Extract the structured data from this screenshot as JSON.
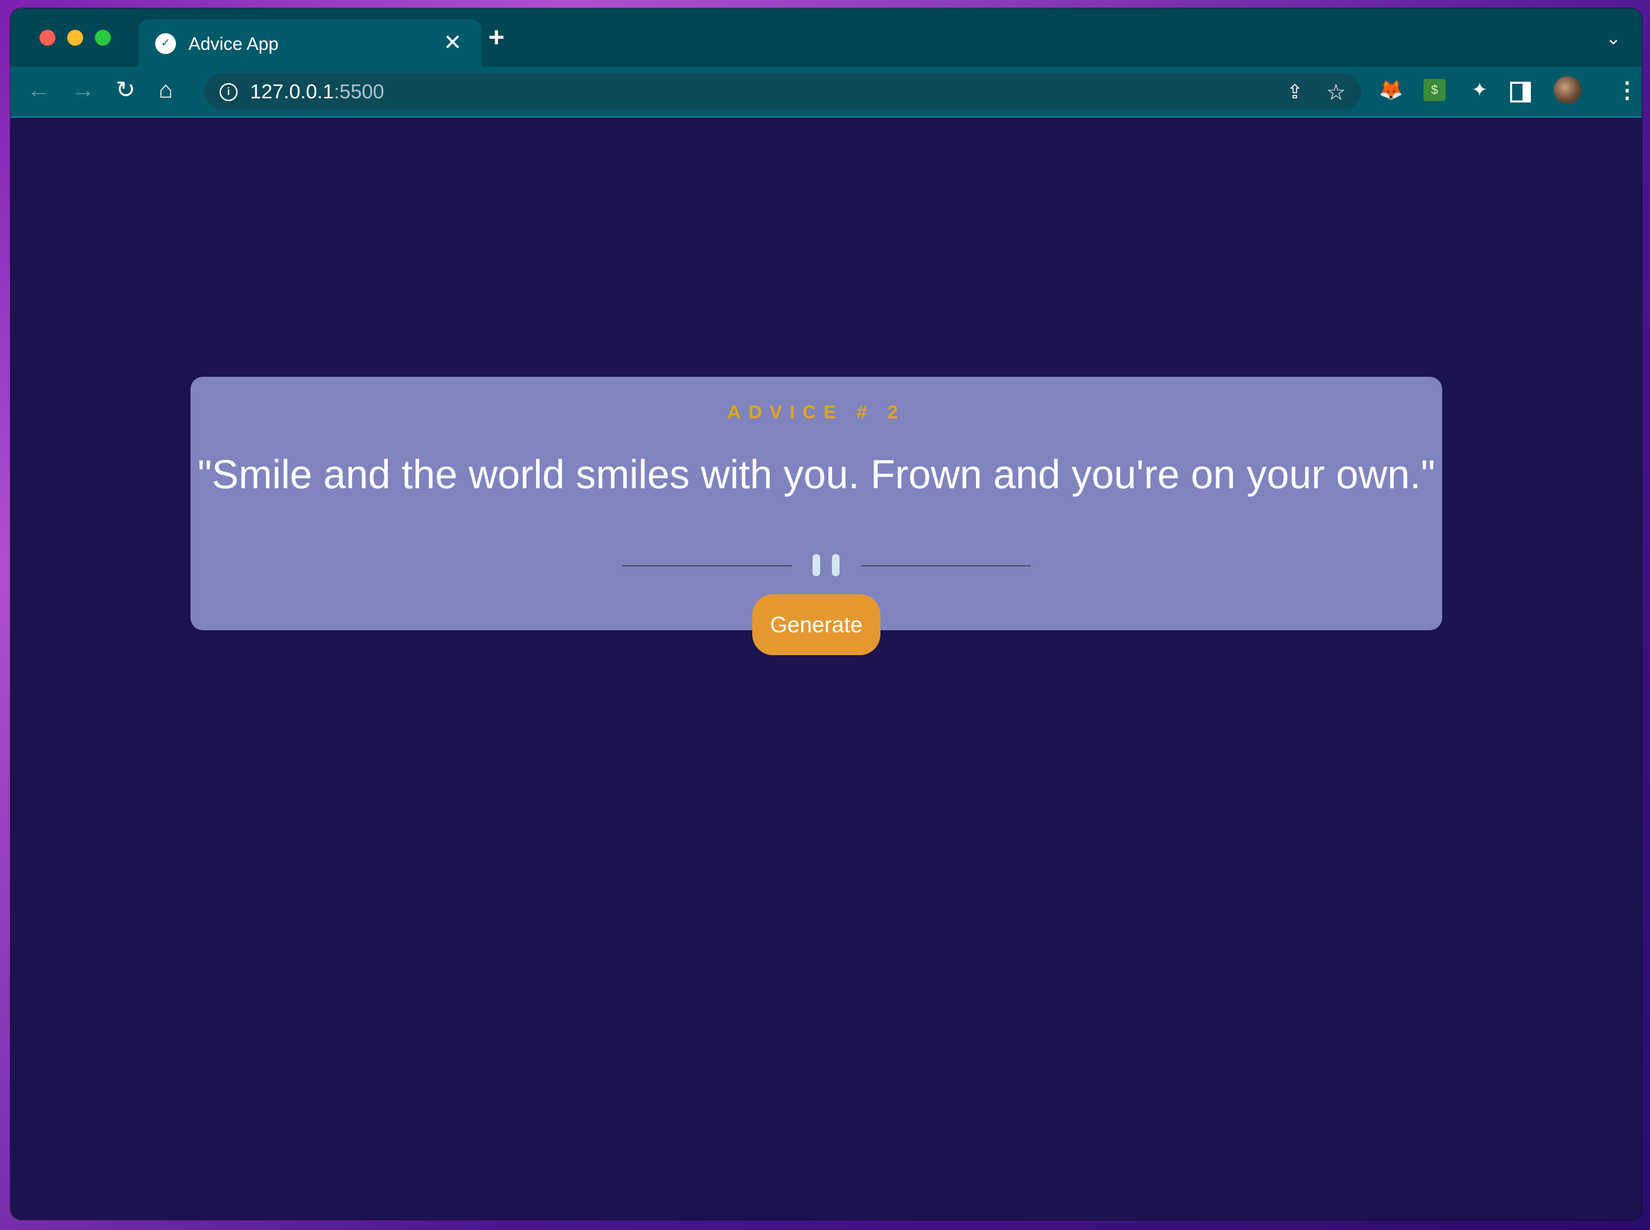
{
  "browser": {
    "tab_title": "Advice App",
    "tab_close": "✕",
    "new_tab": "+",
    "tab_list": "⌄",
    "url_host": "127.0.0.1",
    "url_port": ":5500",
    "nav": {
      "back": "←",
      "forward": "→",
      "reload": "↻",
      "home": "⌂"
    },
    "icons": [
      "info-icon",
      "share-icon",
      "star-icon",
      "fox-icon",
      "money-icon",
      "puzzle-icon",
      "side-panel-icon",
      "avatar",
      "more-icon"
    ]
  },
  "card": {
    "advice_label": "ADVICE # 2",
    "quote": "\"Smile and the world smiles with you. Frown and you're on your own.\"",
    "generate_label": "Generate"
  },
  "colors": {
    "page_bg": "#1b134d",
    "card_bg": "#7f84bf",
    "accent": "#e0a61a",
    "button_bg": "#e5982f",
    "browser_chrome": "#02596a"
  }
}
